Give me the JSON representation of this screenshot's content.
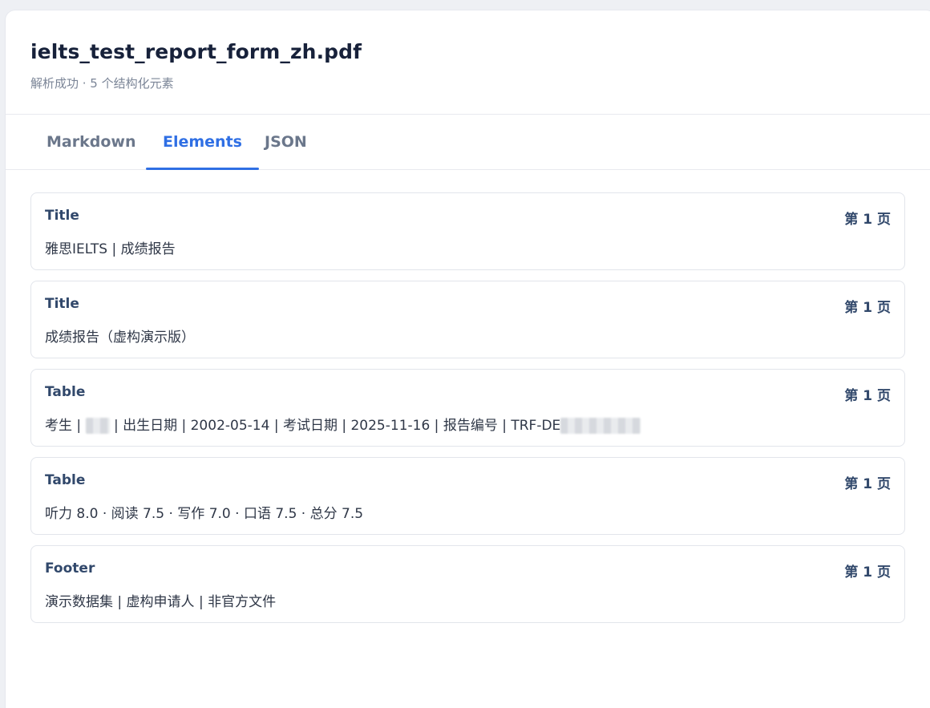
{
  "document": {
    "file_name": "ielts_test_report_form_zh.pdf",
    "status_line": "解析成功 · 5 个结构化元素"
  },
  "tabs": [
    {
      "label": "Markdown",
      "active": false
    },
    {
      "label": "Elements",
      "active": true
    },
    {
      "label": "JSON",
      "active": false
    }
  ],
  "elements": [
    {
      "type": "Title",
      "page": "第 1 页",
      "text": "雅思IELTS | 成绩报告"
    },
    {
      "type": "Title",
      "page": "第 1 页",
      "text": "成绩报告（虚构演示版）"
    },
    {
      "type": "Table",
      "page": "第 1 页",
      "text_parts": [
        "考生 | ",
        "",
        " | 出生日期 | 2002-05-14 | 考试日期 | 2025-11-16 | 报告编号 | TRF-DE",
        ""
      ]
    },
    {
      "type": "Table",
      "page": "第 1 页",
      "text": "听力 8.0 · 阅读 7.5 · 写作 7.0 · 口语 7.5 · 总分 7.5"
    },
    {
      "type": "Footer",
      "page": "第 1 页",
      "text": "演示数据集 | 虚构申请人 | 非官方文件"
    }
  ],
  "colors": {
    "accent": "#2f6fe4",
    "element_type": "#31486b",
    "background": "#eef0f4"
  }
}
